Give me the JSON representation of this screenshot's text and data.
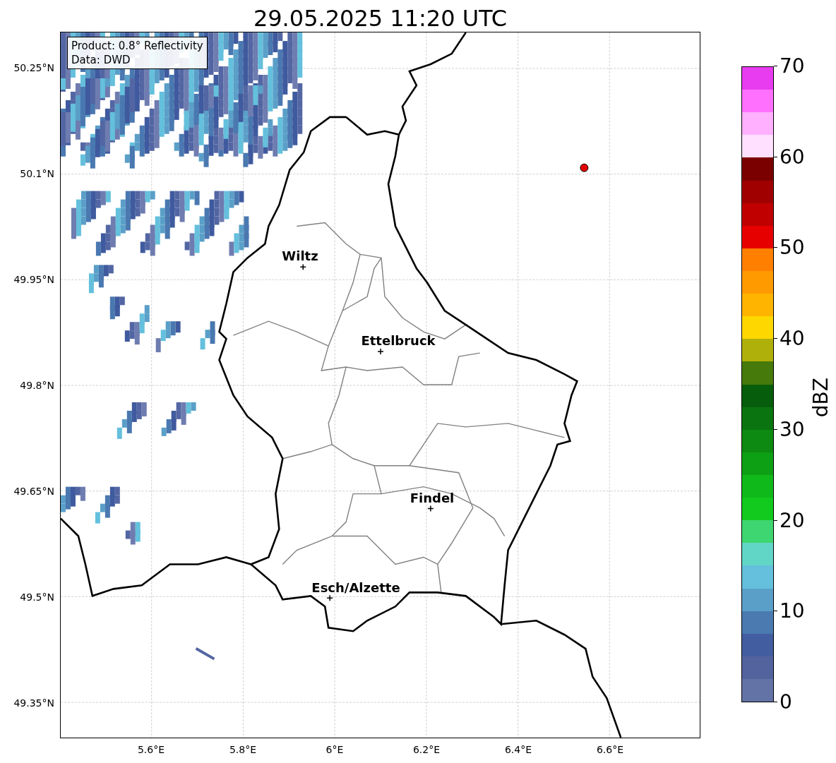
{
  "title": "29.05.2025 11:20 UTC",
  "info_box": [
    "Product: 0.8° Reflectivity",
    "Data: DWD"
  ],
  "cities": [
    {
      "name": "Wiltz"
    },
    {
      "name": "Ettelbruck"
    },
    {
      "name": "Findel"
    },
    {
      "name": "Esch/Alzette"
    }
  ],
  "lat_ticks": [
    "50.25°N",
    "50.1°N",
    "49.95°N",
    "49.8°N",
    "49.65°N",
    "49.5°N",
    "49.35°N"
  ],
  "lon_ticks": [
    "5.6°E",
    "5.8°E",
    "6°E",
    "6.2°E",
    "6.4°E",
    "6.6°E"
  ],
  "colorbar": {
    "label": "dBZ",
    "ticks": [
      "70",
      "60",
      "50",
      "40",
      "30",
      "20",
      "10",
      "0"
    ],
    "bands": [
      {
        "color": "#e83cf0"
      },
      {
        "color": "#ff70ff"
      },
      {
        "color": "#ffb0ff"
      },
      {
        "color": "#ffe0ff"
      },
      {
        "color": "#7a0000"
      },
      {
        "color": "#a00000"
      },
      {
        "color": "#c00000"
      },
      {
        "color": "#e60000"
      },
      {
        "color": "#ff7f00"
      },
      {
        "color": "#ff9a00"
      },
      {
        "color": "#ffb400"
      },
      {
        "color": "#ffd700"
      },
      {
        "color": "#b0b00a"
      },
      {
        "color": "#467a0a"
      },
      {
        "color": "#065e0c"
      },
      {
        "color": "#0a7510"
      },
      {
        "color": "#0c8a12"
      },
      {
        "color": "#0ea014"
      },
      {
        "color": "#10b91a"
      },
      {
        "color": "#12c91e"
      },
      {
        "color": "#3ed670"
      },
      {
        "color": "#62d6c6"
      },
      {
        "color": "#64c0dc"
      },
      {
        "color": "#5a9fc8"
      },
      {
        "color": "#4a7ab0"
      },
      {
        "color": "#435ea0"
      },
      {
        "color": "#53639e"
      },
      {
        "color": "#6373a6"
      }
    ]
  }
}
